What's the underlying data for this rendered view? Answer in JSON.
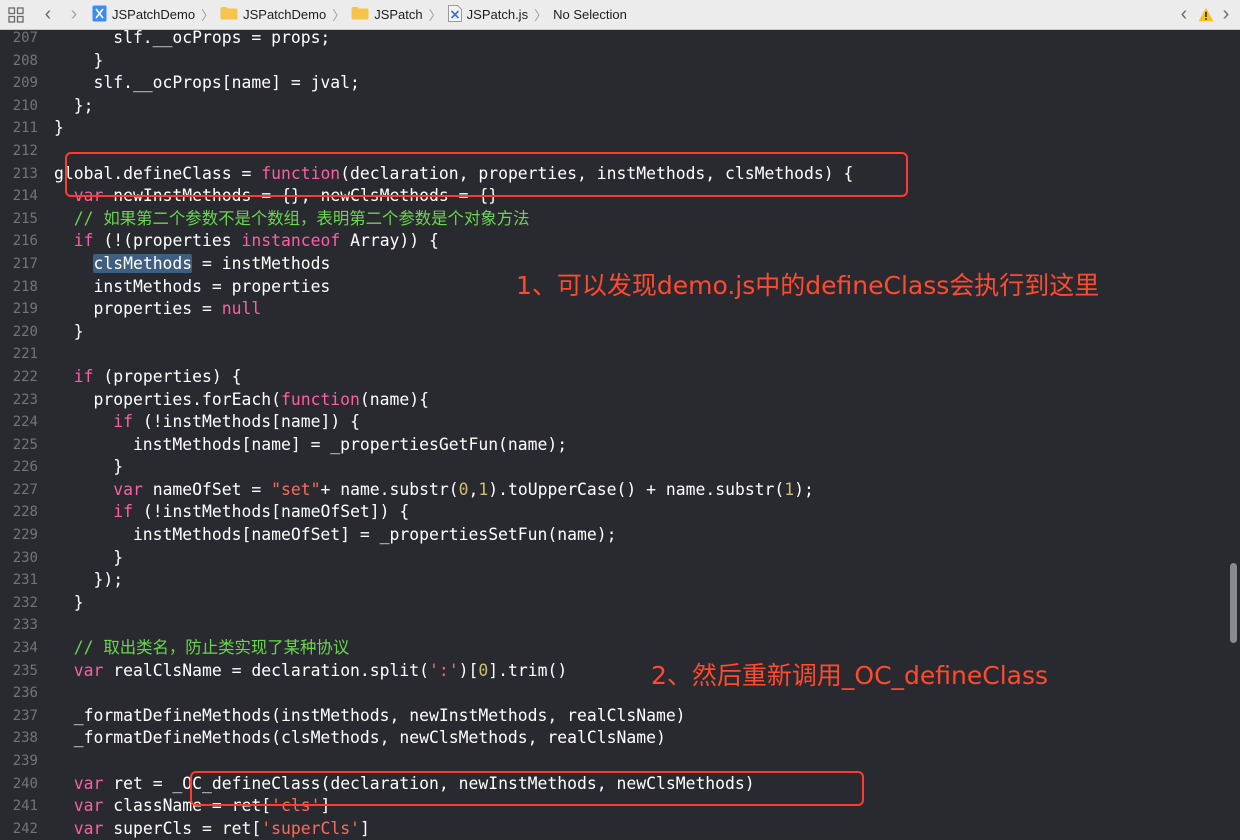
{
  "breadcrumb": {
    "items": [
      "JSPatchDemo",
      "JSPatchDemo",
      "JSPatch",
      "JSPatch.js",
      "No Selection"
    ]
  },
  "editor": {
    "lines": [
      {
        "n": "207",
        "html": "      slf.__ocProps = props;"
      },
      {
        "n": "208",
        "html": "    }"
      },
      {
        "n": "209",
        "html": "    slf.__ocProps[name] = jval;"
      },
      {
        "n": "210",
        "html": "  };"
      },
      {
        "n": "211",
        "html": "}"
      },
      {
        "n": "212",
        "html": ""
      },
      {
        "n": "213",
        "html": "global.defineClass = <span class=\"kw\">function</span>(declaration, properties, instMethods, clsMethods) {"
      },
      {
        "n": "214",
        "html": "  <span class=\"kw\">var</span> newInstMethods = {}, newClsMethods = {}"
      },
      {
        "n": "215",
        "html": "  <span class=\"cmt\">// 如果第二个参数不是个数组，表明第二个参数是个对象方法</span>"
      },
      {
        "n": "216",
        "html": "  <span class=\"kw\">if</span> (!(properties <span class=\"kw\">instanceof</span> Array)) {"
      },
      {
        "n": "217",
        "html": "    <span class=\"hl\">clsMethods</span> = instMethods"
      },
      {
        "n": "218",
        "html": "    instMethods = properties"
      },
      {
        "n": "219",
        "html": "    properties = <span class=\"kw\">null</span>"
      },
      {
        "n": "220",
        "html": "  }"
      },
      {
        "n": "221",
        "html": ""
      },
      {
        "n": "222",
        "html": "  <span class=\"kw\">if</span> (properties) {"
      },
      {
        "n": "223",
        "html": "    properties.forEach(<span class=\"kw\">function</span>(name){"
      },
      {
        "n": "224",
        "html": "      <span class=\"kw\">if</span> (!instMethods[name]) {"
      },
      {
        "n": "225",
        "html": "        instMethods[name] = _propertiesGetFun(name);"
      },
      {
        "n": "226",
        "html": "      }"
      },
      {
        "n": "227",
        "html": "      <span class=\"kw\">var</span> nameOfSet = <span class=\"str\">\"set\"</span>+ name.substr(<span class=\"num\">0</span>,<span class=\"num\">1</span>).toUpperCase() + name.substr(<span class=\"num\">1</span>);"
      },
      {
        "n": "228",
        "html": "      <span class=\"kw\">if</span> (!instMethods[nameOfSet]) {"
      },
      {
        "n": "229",
        "html": "        instMethods[nameOfSet] = _propertiesSetFun(name);"
      },
      {
        "n": "230",
        "html": "      }"
      },
      {
        "n": "231",
        "html": "    });"
      },
      {
        "n": "232",
        "html": "  }"
      },
      {
        "n": "233",
        "html": ""
      },
      {
        "n": "234",
        "html": "  <span class=\"cmt\">// 取出类名，防止类实现了某种协议</span>"
      },
      {
        "n": "235",
        "html": "  <span class=\"kw\">var</span> realClsName = declaration.split(<span class=\"str\">':'</span>)[<span class=\"num\">0</span>].trim()"
      },
      {
        "n": "236",
        "html": ""
      },
      {
        "n": "237",
        "html": "  _formatDefineMethods(instMethods, newInstMethods, realClsName)"
      },
      {
        "n": "238",
        "html": "  _formatDefineMethods(clsMethods, newClsMethods, realClsName)"
      },
      {
        "n": "239",
        "html": ""
      },
      {
        "n": "240",
        "html": "  <span class=\"kw\">var</span> ret = _OC_defineClass(declaration, newInstMethods, newClsMethods)"
      },
      {
        "n": "241",
        "html": "  <span class=\"kw\">var</span> className = ret[<span class=\"str\">'cls'</span>]"
      },
      {
        "n": "242",
        "html": "  <span class=\"kw\">var</span> superCls = ret[<span class=\"str\">'superCls'</span>]"
      }
    ]
  },
  "annotations": {
    "note1": "1、可以发现demo.js中的defineClass会执行到这里",
    "note2": "2、然后重新调用_OC_defineClass"
  },
  "colors": {
    "background": "#292a30",
    "keyword": "#fc5fa3",
    "string": "#fc6a5d",
    "number": "#d0bf69",
    "comment": "#6bd450",
    "annotation": "#ff4a2e"
  }
}
